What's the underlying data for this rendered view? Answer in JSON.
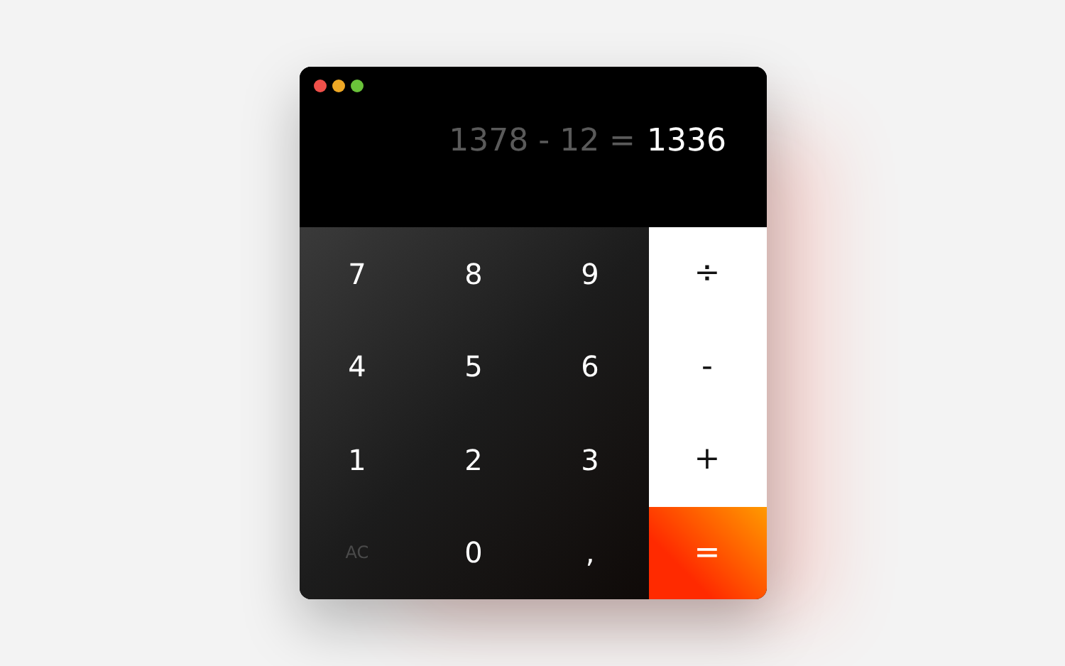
{
  "display": {
    "expression": "1378 - 12 =",
    "result": "1336"
  },
  "keys": [
    {
      "label": "7",
      "kind": "digit"
    },
    {
      "label": "8",
      "kind": "digit"
    },
    {
      "label": "9",
      "kind": "digit"
    },
    {
      "label": "÷",
      "kind": "operator"
    },
    {
      "label": "4",
      "kind": "digit"
    },
    {
      "label": "5",
      "kind": "digit"
    },
    {
      "label": "6",
      "kind": "digit"
    },
    {
      "label": "-",
      "kind": "operator"
    },
    {
      "label": "1",
      "kind": "digit"
    },
    {
      "label": "2",
      "kind": "digit"
    },
    {
      "label": "3",
      "kind": "digit"
    },
    {
      "label": "+",
      "kind": "operator"
    },
    {
      "label": "AC",
      "kind": "clear"
    },
    {
      "label": "0",
      "kind": "digit"
    },
    {
      "label": ",",
      "kind": "digit"
    },
    {
      "label": "=",
      "kind": "equals"
    }
  ]
}
